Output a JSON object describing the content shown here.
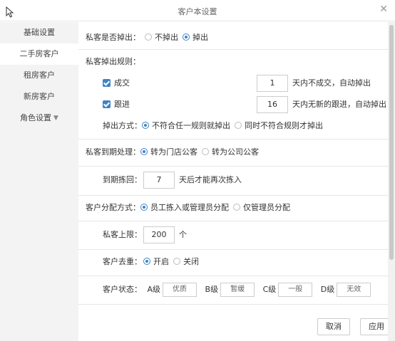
{
  "window": {
    "title": "客户本设置"
  },
  "sidebar": {
    "items": [
      {
        "label": "基础设置"
      },
      {
        "label": "二手房客户"
      },
      {
        "label": "租房客户"
      },
      {
        "label": "新房客户"
      },
      {
        "label": "角色设置"
      }
    ]
  },
  "drop": {
    "label": "私客是否掉出：",
    "options": [
      {
        "label": "不掉出",
        "checked": false
      },
      {
        "label": "掉出",
        "checked": true
      }
    ]
  },
  "rules": {
    "heading": "私客掉出规则：",
    "deal": {
      "label": "成交",
      "checked": true,
      "days": "1",
      "suffix": "天内不成交，自动掉出"
    },
    "follow": {
      "label": "跟进",
      "checked": true,
      "days": "16",
      "suffix": "天内无新的跟进，自动掉出"
    },
    "mode": {
      "label": "掉出方式：",
      "options": [
        {
          "label": "不符合任一规则就掉出",
          "checked": true
        },
        {
          "label": "同时不符合规则才掉出",
          "checked": false
        }
      ]
    }
  },
  "expire": {
    "label": "私客到期处理：",
    "options": [
      {
        "label": "转为门店公客",
        "checked": true
      },
      {
        "label": "转为公司公客",
        "checked": false
      }
    ]
  },
  "reclaim": {
    "label": "到期拣回：",
    "days": "7",
    "suffix": "天后才能再次拣入"
  },
  "assign": {
    "label": "客户分配方式：",
    "options": [
      {
        "label": "员工拣入或管理员分配",
        "checked": true
      },
      {
        "label": "仅管理员分配",
        "checked": false
      }
    ]
  },
  "limit": {
    "label": "私客上限：",
    "value": "200",
    "unit": "个"
  },
  "dedup": {
    "label": "客户去重：",
    "options": [
      {
        "label": "开启",
        "checked": true
      },
      {
        "label": "关闭",
        "checked": false
      }
    ]
  },
  "status": {
    "label": "客户状态：",
    "grades": [
      {
        "grade": "A级",
        "value": "优质"
      },
      {
        "grade": "B级",
        "value": "暂缓"
      },
      {
        "grade": "C级",
        "value": "一般"
      },
      {
        "grade": "D级",
        "value": "无效"
      }
    ]
  },
  "footer": {
    "cancel": "取消",
    "apply": "应用"
  },
  "colors": {
    "accent": "#3e84c6",
    "sidebar_bg": "#f3f3f3",
    "border": "#cccccc"
  },
  "icons": {
    "cursor": "mouse-pointer-icon",
    "close": "close-icon",
    "caret": "caret-down-icon"
  }
}
